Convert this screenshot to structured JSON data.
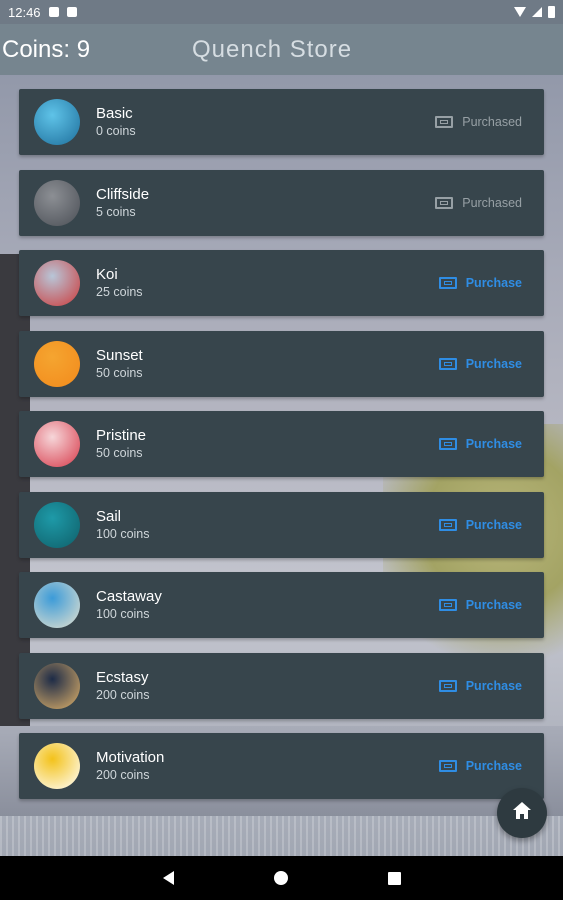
{
  "status_bar": {
    "time": "12:46"
  },
  "header": {
    "coins_label": "Coins: 9",
    "title": "Quench Store"
  },
  "items": [
    {
      "name": "Basic",
      "price": "0 coins",
      "action": "Purchased",
      "state": "purchased",
      "thumb_colors": [
        "#5fc3e8",
        "#1e6f9c"
      ]
    },
    {
      "name": "Cliffside",
      "price": "5 coins",
      "action": "Purchased",
      "state": "purchased",
      "thumb_colors": [
        "#8c8f94",
        "#4b4f56"
      ]
    },
    {
      "name": "Koi",
      "price": "25 coins",
      "action": "Purchase",
      "state": "available",
      "thumb_colors": [
        "#b8c6d8",
        "#cc3a3a"
      ]
    },
    {
      "name": "Sunset",
      "price": "50 coins",
      "action": "Purchase",
      "state": "available",
      "thumb_colors": [
        "#f5a530",
        "#f28a1c"
      ]
    },
    {
      "name": "Pristine",
      "price": "50 coins",
      "action": "Purchase",
      "state": "available",
      "thumb_colors": [
        "#f6d6d9",
        "#d73a4a"
      ]
    },
    {
      "name": "Sail",
      "price": "100 coins",
      "action": "Purchase",
      "state": "available",
      "thumb_colors": [
        "#1e9aa8",
        "#0f5f69"
      ]
    },
    {
      "name": "Castaway",
      "price": "100 coins",
      "action": "Purchase",
      "state": "available",
      "thumb_colors": [
        "#3c9bd8",
        "#e6e2cf"
      ]
    },
    {
      "name": "Ecstasy",
      "price": "200 coins",
      "action": "Purchase",
      "state": "available",
      "thumb_colors": [
        "#1d2b47",
        "#e1b36a"
      ]
    },
    {
      "name": "Motivation",
      "price": "200 coins",
      "action": "Purchase",
      "state": "available",
      "thumb_colors": [
        "#f3c21a",
        "#ffffff"
      ]
    }
  ],
  "colors": {
    "header_bg": "#76858f",
    "card_bg": "#37454c",
    "purchase_accent": "#2f8de4",
    "purchased_gray": "#97a0a5"
  }
}
